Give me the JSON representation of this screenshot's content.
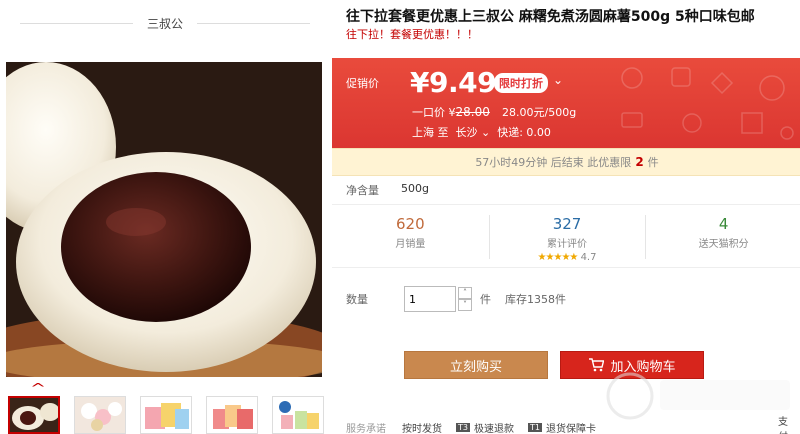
{
  "store": {
    "name": "三叔公"
  },
  "product": {
    "title": "往下拉套餐更优惠上三叔公 麻糬免煮汤圆麻薯500g 5种口味包邮",
    "subtitle": "往下拉！套餐更优惠！！！"
  },
  "promo": {
    "label": "促销价",
    "price": "¥9.49",
    "badge": "限时打折",
    "original_label": "一口价 ¥",
    "original_price": "28.00",
    "unit_price": "28.00元/500g",
    "ship_from": "上海 至",
    "ship_to": "长沙",
    "shipping": "快递: 0.00"
  },
  "timer": {
    "text": "57小时49分钟 后结束   此优惠限",
    "limit": "2",
    "unit": "件"
  },
  "net_weight": {
    "label": "净含量",
    "value": "500g"
  },
  "stats": [
    {
      "value": "620",
      "label": "月销量"
    },
    {
      "value": "327",
      "label": "累计评价",
      "stars": "★★★★★",
      "rating": "4.7"
    },
    {
      "value": "4",
      "label": "送天猫积分"
    }
  ],
  "quantity": {
    "label": "数量",
    "value": "1",
    "unit": "件",
    "stock": "库存1358件",
    "up": "˄",
    "down": "˅"
  },
  "buttons": {
    "buy": "立刻购买",
    "cart": "加入购物车"
  },
  "service": {
    "label": "服务承诺",
    "items": [
      {
        "tag": "",
        "text": "按时发货"
      },
      {
        "tag": "T3",
        "text": "极速退款"
      },
      {
        "tag": "T1",
        "text": "退货保障卡"
      }
    ],
    "pay": "支付"
  },
  "colors": {
    "accent": "#e4393c",
    "buy": "#c9884e",
    "cart": "#d7251c",
    "timer_bg": "#fff3d3"
  },
  "icons": [
    "chevron-down-icon",
    "chevron-up-icon",
    "cart-icon",
    "star-icon"
  ]
}
